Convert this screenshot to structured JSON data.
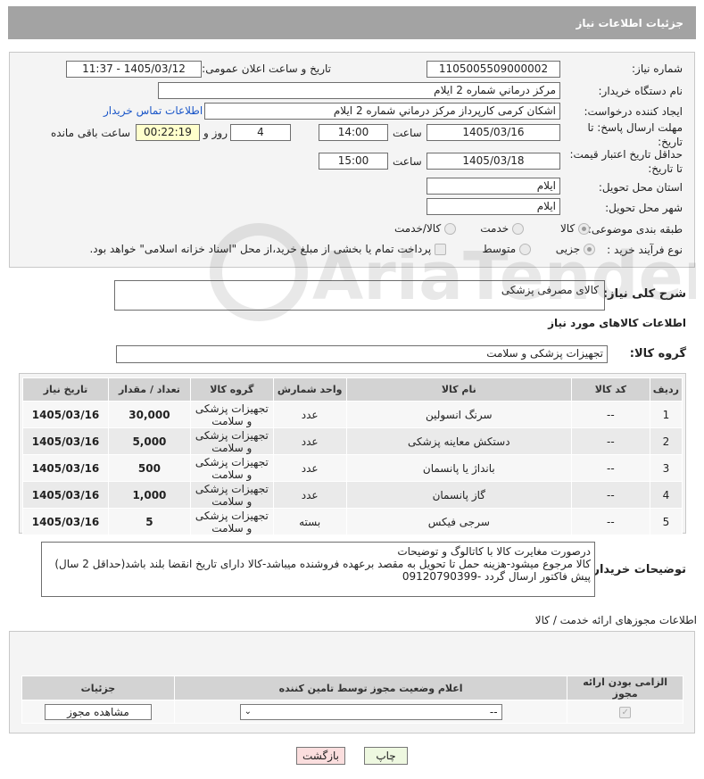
{
  "title": "جزئیات اطلاعات نیاز",
  "form": {
    "need_number_label": "شماره نیاز:",
    "need_number": "1105005509000002",
    "announce_label": "تاریخ و ساعت اعلان عمومی:",
    "announce_value": "1405/03/12 - 11:37",
    "buyer_org_label": "نام دستگاه خریدار:",
    "buyer_org": "مرکز درماني شماره 2 ايلام",
    "requester_label": "ایجاد کننده درخواست:",
    "requester": "اشکان کرمی کارپرداز مرکز درماني شماره 2 ايلام",
    "buyer_contact_link": "اطلاعات تماس خریدار",
    "deadline_label_1": "مهلت ارسال پاسخ: تا",
    "deadline_label_2": "تاریخ:",
    "deadline_date": "1405/03/16",
    "time_label": "ساعت",
    "deadline_time": "14:00",
    "days_value": "4",
    "days_label": "روز و",
    "remaining_time": "00:22:19",
    "remaining_label": "ساعت باقی مانده",
    "validity_label_1": "حداقل تاریخ اعتبار قیمت:",
    "validity_label_2": "تا تاریخ:",
    "validity_date": "1405/03/18",
    "validity_time": "15:00",
    "province_label": "استان محل تحویل:",
    "province": "ايلام",
    "city_label": "شهر محل تحویل:",
    "city": "ايلام",
    "category_label": "طبقه بندی موضوعی:",
    "category_options": [
      "کالا",
      "خدمت",
      "کالا/خدمت"
    ],
    "category_selected": "کالا",
    "purchase_type_label": "نوع فرآیند خرید :",
    "purchase_options": [
      "جزیی",
      "متوسط"
    ],
    "payment_note": "پرداخت تمام یا بخشی از مبلغ خرید،از محل \"اسناد خزانه اسلامی\" خواهد بود."
  },
  "description": {
    "label": "شرح کلی نیاز:",
    "value": "کالای مصرفی پزشکی"
  },
  "goods": {
    "section_title": "اطلاعات کالاهای مورد نیاز",
    "group_label": "گروه کالا:",
    "group_value": "تجهیزات پزشکی و سلامت",
    "columns": [
      "ردیف",
      "کد کالا",
      "نام کالا",
      "واحد شمارش",
      "گروه کالا",
      "تعداد / مقدار",
      "تاریخ نیاز"
    ],
    "rows": [
      {
        "num": "1",
        "code": "--",
        "name": "سرنگ انسولین",
        "unit": "عدد",
        "group": "تجهیزات پزشکی و سلامت",
        "qty": "30,000",
        "date": "1405/03/16"
      },
      {
        "num": "2",
        "code": "--",
        "name": "دستکش معاینه پزشکی",
        "unit": "عدد",
        "group": "تجهیزات پزشکی و سلامت",
        "qty": "5,000",
        "date": "1405/03/16"
      },
      {
        "num": "3",
        "code": "--",
        "name": "بانداژ یا پانسمان",
        "unit": "عدد",
        "group": "تجهیزات پزشکی و سلامت",
        "qty": "500",
        "date": "1405/03/16"
      },
      {
        "num": "4",
        "code": "--",
        "name": "گاز پانسمان",
        "unit": "عدد",
        "group": "تجهیزات پزشکی و سلامت",
        "qty": "1,000",
        "date": "1405/03/16"
      },
      {
        "num": "5",
        "code": "--",
        "name": "سرجی فیکس",
        "unit": "بسته",
        "group": "تجهیزات پزشکی و سلامت",
        "qty": "5",
        "date": "1405/03/16"
      }
    ]
  },
  "buyer_notes": {
    "label": "توضیحات خریدار:",
    "line1": "درصورت مغایرت کالا با کاتالوگ و توضیحات",
    "line2": "کالا مرجوع میشود-هزینه حمل تا تحویل به مقصد برعهده فروشنده میباشد-کالا دارای تاریخ انقضا بلند باشد(حداقل 2 سال)",
    "line3": "پیش فاکتور ارسال گردد -09120790399"
  },
  "permits": {
    "section_title": "اطلاعات مجوزهای ارائه خدمت / کالا",
    "columns": [
      "الزامی بودن ارائه مجوز",
      "اعلام وضعیت مجوز توسط تامین کننده",
      "جزئیات"
    ],
    "select_value": "--",
    "view_button": "مشاهده مجوز"
  },
  "buttons": {
    "print": "چاپ",
    "back": "بازگشت"
  },
  "watermark_text": "AriaTender.net"
}
